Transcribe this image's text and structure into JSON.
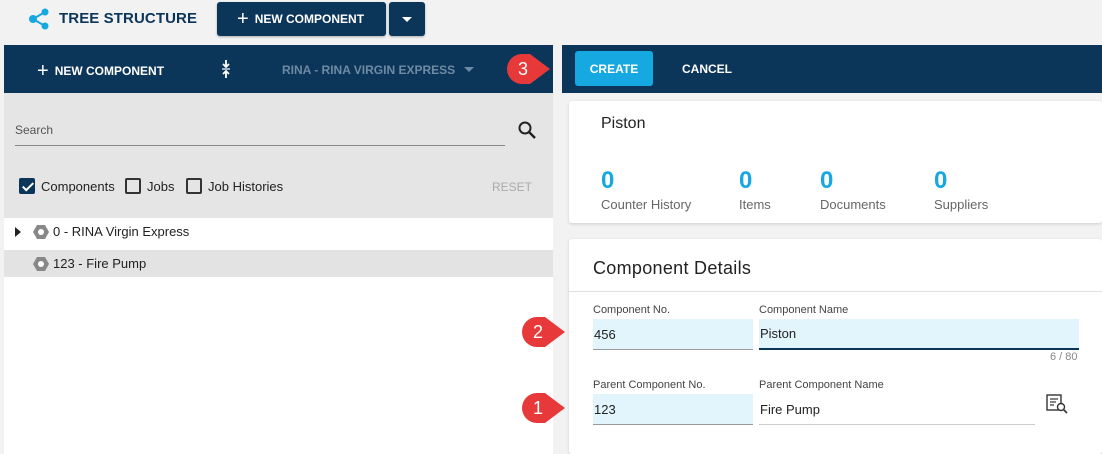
{
  "app": {
    "title": "TREE STRUCTURE"
  },
  "toolbar": {
    "new_component_label": "NEW COMPONENT"
  },
  "left_toolbar": {
    "new_component_label": "NEW COMPONENT",
    "vessel_selector": "RINA - RINA VIRGIN EXPRESS"
  },
  "right_toolbar": {
    "create_label": "CREATE",
    "cancel_label": "CANCEL"
  },
  "search": {
    "placeholder": "Search"
  },
  "filters": {
    "components": {
      "label": "Components",
      "checked": true
    },
    "jobs": {
      "label": "Jobs",
      "checked": false
    },
    "job_histories": {
      "label": "Job Histories",
      "checked": false
    },
    "reset_label": "RESET"
  },
  "tree": {
    "items": [
      {
        "label": "0 - RINA Virgin Express"
      },
      {
        "label": "123 - Fire Pump"
      }
    ]
  },
  "component": {
    "name": "Piston",
    "stats": [
      {
        "value": "0",
        "label": "Counter History"
      },
      {
        "value": "0",
        "label": "Items"
      },
      {
        "value": "0",
        "label": "Documents"
      },
      {
        "value": "0",
        "label": "Suppliers"
      }
    ]
  },
  "details": {
    "title": "Component Details",
    "component_no_label": "Component No.",
    "component_no_value": "456",
    "component_name_label": "Component Name",
    "component_name_value": "Piston",
    "name_counter": "6 / 80",
    "parent_no_label": "Parent Component No.",
    "parent_no_value": "123",
    "parent_name_label": "Parent Component Name",
    "parent_name_value": "Fire Pump"
  },
  "annotations": [
    {
      "number": "1"
    },
    {
      "number": "2"
    },
    {
      "number": "3"
    }
  ],
  "colors": {
    "navy": "#0b3559",
    "accent": "#16a8e0",
    "marker": "#e8393a"
  }
}
